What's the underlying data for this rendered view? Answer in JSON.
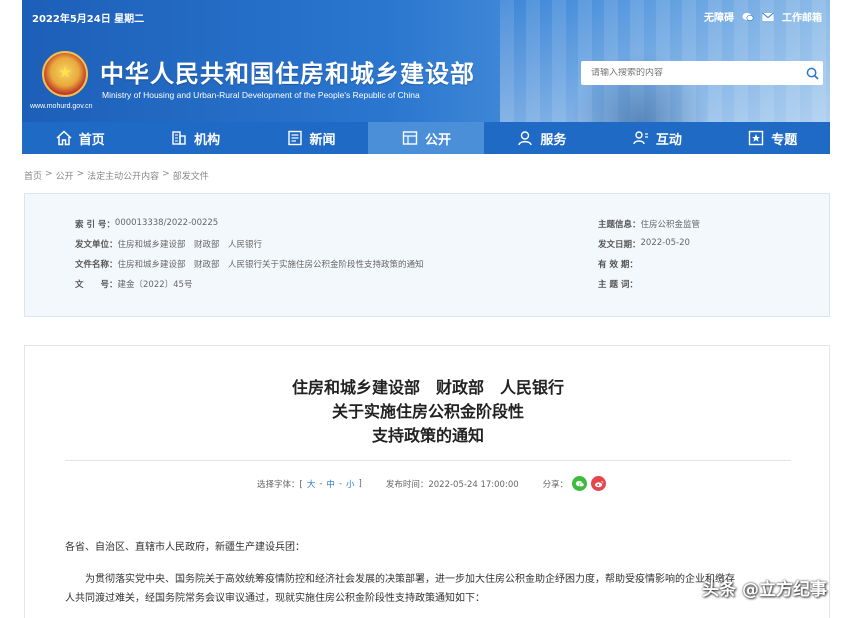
{
  "header": {
    "date": "2022年5月24日 星期二",
    "accessibility": "无障碍",
    "work_email": "工作邮箱",
    "site_title": "中华人民共和国住房和城乡建设部",
    "site_subtitle": "Ministry of Housing and Urban-Rural Development of the People's Republic of China",
    "site_url": "www.mohurd.gov.cn",
    "search_placeholder": "请输入搜索的内容"
  },
  "nav": {
    "items": [
      {
        "label": "首页",
        "icon": "home-icon"
      },
      {
        "label": "机构",
        "icon": "building-icon"
      },
      {
        "label": "新闻",
        "icon": "news-icon"
      },
      {
        "label": "公开",
        "icon": "open-icon",
        "active": true
      },
      {
        "label": "服务",
        "icon": "service-icon"
      },
      {
        "label": "互动",
        "icon": "interact-icon"
      },
      {
        "label": "专题",
        "icon": "topic-icon"
      }
    ]
  },
  "breadcrumb": {
    "items": [
      "首页",
      "公开",
      "法定主动公开内容",
      "部发文件"
    ],
    "sep": ">"
  },
  "info": {
    "index_k": "索 引 号：",
    "index_v": "000013338/2022-00225",
    "issuer_k": "发文单位：",
    "issuer_v": "住房和城乡建设部　财政部　人民银行",
    "filename_k": "文件名称：",
    "filename_v": "住房和城乡建设部　财政部　人民银行关于实施住房公积金阶段性支持政策的通知",
    "docno_k": "文　　号：",
    "docno_v": "建金〔2022〕45号",
    "topic_k": "主题信息：",
    "topic_v": "住房公积金监管",
    "date_k": "发文日期：",
    "date_v": "2022-05-20",
    "validity_k": "有 效 期：",
    "validity_v": "",
    "keywords_k": "主 题 词：",
    "keywords_v": ""
  },
  "article": {
    "title_line1": "住房和城乡建设部　财政部　人民银行",
    "title_line2": "关于实施住房公积金阶段性",
    "title_line3": "支持政策的通知",
    "font_label": "选择字体：[",
    "font_large": "大",
    "font_sep1": "-",
    "font_medium": "中",
    "font_sep2": "-",
    "font_small": "小",
    "font_close": "]",
    "publish_label": "发布时间：2022-05-24 17:00:00",
    "share_label": "分享：",
    "salutation": "各省、自治区、直辖市人民政府，新疆生产建设兵团：",
    "para1_line1": "为贯彻落实党中央、国务院关于高效统筹疫情防控和经济社会发展的决策部署，进一步加大住房公积金助企纾困力度，帮助受疫情影响的企业和缴存",
    "para1_line2": "人共同渡过难关，经国务院常务会议审议通过，现就实施住房公积金阶段性支持政策通知如下："
  },
  "watermark": "头条 @立方纪事",
  "colors": {
    "nav_bg": "#1f6ac4",
    "nav_active": "#4a8fd8",
    "info_bg": "#f3f8fd",
    "link": "#2a76cf"
  }
}
